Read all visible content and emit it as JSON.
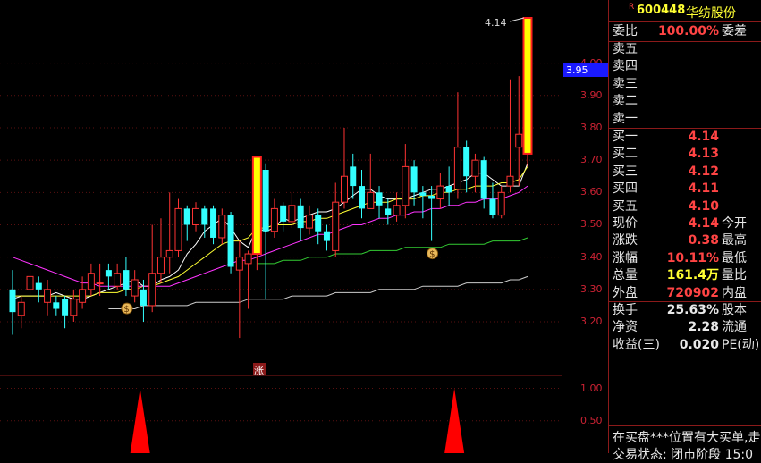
{
  "stock": {
    "flag": "R",
    "code": "600448",
    "name": "华纺股份"
  },
  "axis": {
    "price_ticks": [
      "4.00",
      "3.90",
      "3.80",
      "3.70",
      "3.60",
      "3.50",
      "3.40",
      "3.30",
      "3.20"
    ],
    "indicator_ticks": [
      "1.00",
      "0.50"
    ],
    "current_price_marker": "3.95"
  },
  "chart_annotations": {
    "high_label": "4.14",
    "limit_up_badge": "涨"
  },
  "order_book": {
    "ratio_label": "委比",
    "ratio_value": "100.00%",
    "diff_label": "委差",
    "sells": [
      {
        "label": "卖五",
        "price": ""
      },
      {
        "label": "卖四",
        "price": ""
      },
      {
        "label": "卖三",
        "price": ""
      },
      {
        "label": "卖二",
        "price": ""
      },
      {
        "label": "卖一",
        "price": ""
      }
    ],
    "buys": [
      {
        "label": "买一",
        "price": "4.14"
      },
      {
        "label": "买二",
        "price": "4.13"
      },
      {
        "label": "买三",
        "price": "4.12"
      },
      {
        "label": "买四",
        "price": "4.11"
      },
      {
        "label": "买五",
        "price": "4.10"
      }
    ]
  },
  "quote": [
    {
      "label": "现价",
      "value": "4.14",
      "label2": "今开",
      "color": "red"
    },
    {
      "label": "涨跌",
      "value": "0.38",
      "label2": "最高",
      "color": "red"
    },
    {
      "label": "涨幅",
      "value": "10.11%",
      "label2": "最低",
      "color": "red"
    },
    {
      "label": "总量",
      "value": "161.4万",
      "label2": "量比",
      "color": "yellow"
    },
    {
      "label": "外盘",
      "value": "720902",
      "label2": "内盘",
      "color": "red"
    }
  ],
  "fundamentals": [
    {
      "label": "换手",
      "value": "25.63%",
      "label2": "股本"
    },
    {
      "label": "净资",
      "value": "2.28",
      "label2": "流通"
    },
    {
      "label": "收益(三)",
      "value": "0.020",
      "label2": "PE(动)"
    }
  ],
  "ticker": {
    "line1": "在买盘***位置有大买单,走",
    "line2": "交易状态: 闭市阶段 15:0"
  },
  "colors": {
    "up": "#ff3333",
    "down": "#33ffff",
    "limit_bar_fill": "#ffff00",
    "limit_bar_edge": "#ff2020",
    "ma5": "#ffffff",
    "ma10": "#ffff33",
    "ma20": "#ff33ff",
    "ma60": "#33cc33",
    "ma120": "#cccccc"
  },
  "chart_data": {
    "type": "candlestick",
    "title": "",
    "ylim": [
      3.13,
      4.15
    ],
    "candles": [
      [
        3.3,
        3.23,
        3.36,
        3.16
      ],
      [
        3.22,
        3.26,
        3.28,
        3.18
      ],
      [
        3.3,
        3.34,
        3.36,
        3.28
      ],
      [
        3.32,
        3.3,
        3.34,
        3.26
      ],
      [
        3.26,
        3.3,
        3.33,
        3.22
      ],
      [
        3.26,
        3.24,
        3.28,
        3.22
      ],
      [
        3.27,
        3.22,
        3.28,
        3.18
      ],
      [
        3.22,
        3.27,
        3.3,
        3.2
      ],
      [
        3.26,
        3.3,
        3.34,
        3.24
      ],
      [
        3.3,
        3.35,
        3.38,
        3.28
      ],
      [
        3.32,
        3.32,
        3.38,
        3.28
      ],
      [
        3.36,
        3.34,
        3.38,
        3.3
      ],
      [
        3.31,
        3.35,
        3.38,
        3.3
      ],
      [
        3.36,
        3.3,
        3.4,
        3.28
      ],
      [
        3.28,
        3.33,
        3.36,
        3.26
      ],
      [
        3.3,
        3.25,
        3.33,
        3.2
      ],
      [
        3.25,
        3.35,
        3.5,
        3.23
      ],
      [
        3.35,
        3.4,
        3.52,
        3.32
      ],
      [
        3.4,
        3.42,
        3.6,
        3.35
      ],
      [
        3.42,
        3.55,
        3.58,
        3.4
      ],
      [
        3.55,
        3.5,
        3.56,
        3.45
      ],
      [
        3.5,
        3.55,
        3.57,
        3.48
      ],
      [
        3.55,
        3.5,
        3.56,
        3.46
      ],
      [
        3.55,
        3.46,
        3.56,
        3.44
      ],
      [
        3.46,
        3.53,
        3.55,
        3.44
      ],
      [
        3.53,
        3.37,
        3.54,
        3.35
      ],
      [
        3.36,
        3.4,
        3.45,
        3.15
      ],
      [
        3.38,
        3.41,
        3.42,
        3.24
      ],
      [
        3.41,
        3.71,
        3.71,
        3.36
      ],
      [
        3.67,
        3.48,
        3.69,
        3.27
      ],
      [
        3.48,
        3.55,
        3.58,
        3.46
      ],
      [
        3.56,
        3.51,
        3.57,
        3.48
      ],
      [
        3.51,
        3.56,
        3.6,
        3.49
      ],
      [
        3.56,
        3.49,
        3.58,
        3.45
      ],
      [
        3.49,
        3.53,
        3.56,
        3.47
      ],
      [
        3.53,
        3.48,
        3.55,
        3.44
      ],
      [
        3.48,
        3.45,
        3.5,
        3.42
      ],
      [
        3.42,
        3.57,
        3.63,
        3.4
      ],
      [
        3.57,
        3.65,
        3.8,
        3.55
      ],
      [
        3.68,
        3.62,
        3.72,
        3.58
      ],
      [
        3.62,
        3.55,
        3.67,
        3.52
      ],
      [
        3.55,
        3.6,
        3.72,
        3.55
      ],
      [
        3.6,
        3.56,
        3.62,
        3.52
      ],
      [
        3.55,
        3.53,
        3.58,
        3.5
      ],
      [
        3.53,
        3.56,
        3.6,
        3.51
      ],
      [
        3.56,
        3.68,
        3.75,
        3.52
      ],
      [
        3.68,
        3.6,
        3.7,
        3.56
      ],
      [
        3.6,
        3.59,
        3.62,
        3.52
      ],
      [
        3.59,
        3.58,
        3.62,
        3.45
      ],
      [
        3.58,
        3.62,
        3.66,
        3.55
      ],
      [
        3.62,
        3.6,
        3.68,
        3.56
      ],
      [
        3.61,
        3.74,
        3.91,
        3.58
      ],
      [
        3.74,
        3.65,
        3.76,
        3.6
      ],
      [
        3.65,
        3.7,
        3.72,
        3.6
      ],
      [
        3.7,
        3.58,
        3.71,
        3.55
      ],
      [
        3.58,
        3.53,
        3.63,
        3.52
      ],
      [
        3.53,
        3.6,
        3.62,
        3.52
      ],
      [
        3.62,
        3.65,
        3.95,
        3.6
      ],
      [
        3.74,
        3.78,
        3.96,
        3.62
      ],
      [
        3.72,
        4.14,
        4.14,
        3.68
      ]
    ],
    "limit_up_bars": [
      28,
      59
    ],
    "moving_averages": [
      {
        "key": "ma5",
        "values": [
          3.27,
          3.28,
          3.28,
          3.28,
          3.28,
          3.29,
          3.28,
          3.27,
          3.27,
          3.28,
          3.29,
          3.3,
          3.31,
          3.32,
          3.33,
          3.31,
          3.31,
          3.33,
          3.34,
          3.36,
          3.41,
          3.44,
          3.48,
          3.5,
          3.52,
          3.49,
          3.45,
          3.43,
          3.49,
          3.48,
          3.49,
          3.52,
          3.51,
          3.52,
          3.53,
          3.54,
          3.54,
          3.55,
          3.57,
          3.59,
          3.61,
          3.61,
          3.59,
          3.58,
          3.58,
          3.58,
          3.59,
          3.6,
          3.61,
          3.61,
          3.62,
          3.63,
          3.64,
          3.66,
          3.66,
          3.64,
          3.62,
          3.62,
          3.62,
          3.69
        ]
      },
      {
        "key": "ma10",
        "values": [
          3.28,
          3.28,
          3.28,
          3.28,
          3.28,
          3.28,
          3.28,
          3.28,
          3.28,
          3.28,
          3.29,
          3.29,
          3.29,
          3.3,
          3.3,
          3.31,
          3.31,
          3.32,
          3.33,
          3.34,
          3.36,
          3.38,
          3.4,
          3.42,
          3.44,
          3.45,
          3.45,
          3.46,
          3.49,
          3.49,
          3.5,
          3.5,
          3.5,
          3.51,
          3.51,
          3.52,
          3.52,
          3.53,
          3.54,
          3.55,
          3.56,
          3.57,
          3.57,
          3.57,
          3.58,
          3.58,
          3.58,
          3.59,
          3.59,
          3.6,
          3.6,
          3.61,
          3.61,
          3.62,
          3.62,
          3.62,
          3.63,
          3.63,
          3.64,
          3.68
        ]
      },
      {
        "key": "ma20",
        "values": [
          3.4,
          3.39,
          3.38,
          3.37,
          3.36,
          3.35,
          3.34,
          3.33,
          3.32,
          3.32,
          3.31,
          3.31,
          3.31,
          3.31,
          3.31,
          3.31,
          3.31,
          3.31,
          3.31,
          3.32,
          3.33,
          3.34,
          3.35,
          3.36,
          3.37,
          3.38,
          3.39,
          3.39,
          3.4,
          3.41,
          3.42,
          3.43,
          3.44,
          3.45,
          3.46,
          3.47,
          3.47,
          3.48,
          3.49,
          3.5,
          3.5,
          3.51,
          3.52,
          3.52,
          3.53,
          3.53,
          3.54,
          3.54,
          3.55,
          3.55,
          3.56,
          3.56,
          3.57,
          3.57,
          3.58,
          3.58,
          3.58,
          3.59,
          3.6,
          3.62
        ]
      },
      {
        "key": "ma60",
        "values": [
          null,
          null,
          null,
          null,
          null,
          null,
          null,
          null,
          null,
          null,
          null,
          null,
          null,
          null,
          null,
          null,
          null,
          null,
          null,
          null,
          null,
          null,
          null,
          null,
          null,
          null,
          null,
          null,
          3.38,
          3.38,
          3.38,
          3.39,
          3.39,
          3.39,
          3.4,
          3.4,
          3.4,
          3.41,
          3.41,
          3.41,
          3.41,
          3.42,
          3.42,
          3.42,
          3.42,
          3.43,
          3.43,
          3.43,
          3.43,
          3.43,
          3.44,
          3.44,
          3.44,
          3.44,
          3.44,
          3.45,
          3.45,
          3.45,
          3.45,
          3.46
        ]
      },
      {
        "key": "ma120",
        "values": [
          null,
          null,
          null,
          null,
          null,
          null,
          null,
          null,
          null,
          null,
          null,
          3.24,
          3.24,
          3.24,
          3.24,
          3.25,
          3.25,
          3.25,
          3.25,
          3.25,
          3.25,
          3.26,
          3.26,
          3.26,
          3.26,
          3.26,
          3.26,
          3.27,
          3.27,
          3.27,
          3.27,
          3.27,
          3.28,
          3.28,
          3.28,
          3.28,
          3.28,
          3.29,
          3.29,
          3.29,
          3.29,
          3.29,
          3.3,
          3.3,
          3.3,
          3.3,
          3.3,
          3.31,
          3.31,
          3.31,
          3.31,
          3.31,
          3.32,
          3.32,
          3.32,
          3.32,
          3.32,
          3.33,
          3.33,
          3.34
        ]
      }
    ],
    "signal_markers": [
      13,
      48
    ],
    "indicator": {
      "ylim": [
        0,
        1.2
      ],
      "spikes": [
        14,
        50
      ],
      "values": [
        1.0,
        1.0
      ]
    }
  }
}
